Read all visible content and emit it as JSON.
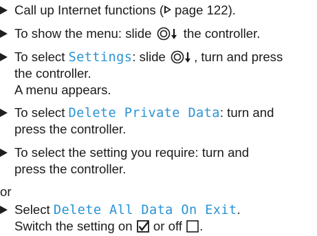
{
  "steps": [
    {
      "text": "Call up Internet functions (",
      "page_ref": "page 122",
      "text_end": ")."
    },
    {
      "text_before": "To show the menu: slide ",
      "text_after": " the controller."
    },
    {
      "text_before": "To select ",
      "keyword": "Settings",
      "text_middle": ": slide ",
      "text_after": ", turn and press",
      "continuation": "the controller.",
      "result": "A menu appears."
    },
    {
      "text_before": "To select ",
      "keyword": "Delete Private Data",
      "text_after": ": turn and",
      "continuation": "press the controller."
    },
    {
      "line1": "To select the setting you require: turn and",
      "line2": "press the controller."
    }
  ],
  "or_label": "or",
  "final_step": {
    "text_before": "Select ",
    "keyword": "Delete All Data On Exit",
    "text_end": ".",
    "switch_before": "Switch the setting on ",
    "switch_middle": " or off ",
    "switch_end": "."
  },
  "icons": {
    "bullet": "bullet-triangle-icon",
    "page_ref": "page-reference-triangle-icon",
    "controller_slide_down": "controller-slide-down-icon",
    "checkbox_on": "checkbox-checked-icon",
    "checkbox_off": "checkbox-empty-icon"
  },
  "colors": {
    "keyword": "#2a93d4",
    "text": "#1a1a1a"
  }
}
